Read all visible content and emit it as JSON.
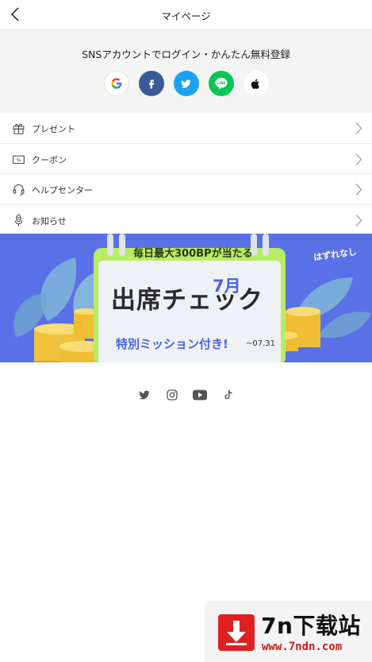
{
  "header": {
    "title": "マイページ"
  },
  "sns": {
    "caption": "SNSアカウントでログイン・かんたん無料登録",
    "buttons": [
      {
        "name": "google",
        "icon": "google-icon"
      },
      {
        "name": "facebook",
        "icon": "facebook-icon",
        "color": "#3b5998"
      },
      {
        "name": "twitter",
        "icon": "twitter-icon",
        "color": "#1da1f2"
      },
      {
        "name": "line",
        "icon": "line-icon",
        "color": "#06c755",
        "label": "LINE"
      },
      {
        "name": "apple",
        "icon": "apple-icon"
      }
    ]
  },
  "menu": {
    "items": [
      {
        "label": "プレゼント",
        "icon": "gift-icon"
      },
      {
        "label": "クーポン",
        "icon": "coupon-icon",
        "icon_text": "%"
      },
      {
        "label": "ヘルプセンター",
        "icon": "headset-icon"
      },
      {
        "label": "お知らせ",
        "icon": "microphone-icon"
      }
    ]
  },
  "banner": {
    "top_tag": "毎日最大300BPが当たる",
    "top_tag_small": "最大",
    "headline": "出席チェック",
    "month": "7月",
    "subline": "特別ミッション付き!",
    "date": "~07.31",
    "side_note": "はずれなし",
    "colors": {
      "background": "#5a70e6",
      "calendar": "#b9ec63"
    }
  },
  "footer_social": [
    {
      "name": "twitter",
      "icon": "twitter-icon"
    },
    {
      "name": "instagram",
      "icon": "instagram-icon"
    },
    {
      "name": "youtube",
      "icon": "youtube-icon"
    },
    {
      "name": "tiktok",
      "icon": "tiktok-icon"
    }
  ],
  "watermark": {
    "title": "7n下载站",
    "url": "www.7ndn.com"
  }
}
